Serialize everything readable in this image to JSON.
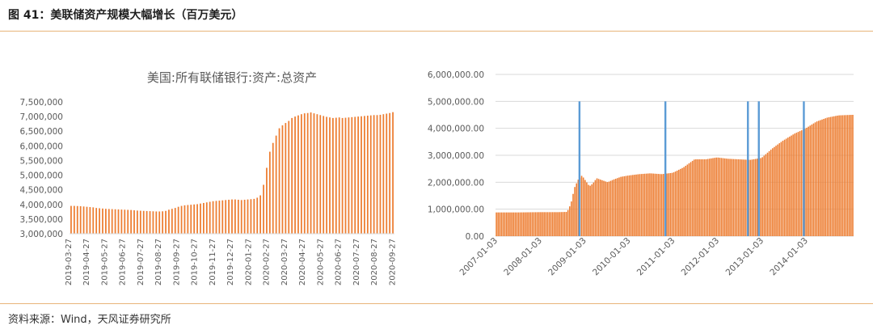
{
  "figure": {
    "title": "图 41：美联储资产规模大幅增长（百万美元）",
    "source": "资料来源：Wind，天风证券研究所"
  },
  "chart_data": [
    {
      "type": "bar",
      "title": "美国:所有联储银行:资产:总资产",
      "xlabel": "",
      "ylabel": "",
      "ylim": [
        3000000,
        7500000
      ],
      "yticks": [
        "3,000,000",
        "3,500,000",
        "4,000,000",
        "4,500,000",
        "5,000,000",
        "5,500,000",
        "6,000,000",
        "6,500,000",
        "7,000,000",
        "7,500,000"
      ],
      "xtick_labels": [
        "2019-03-27",
        "2019-04-27",
        "2019-05-27",
        "2019-06-27",
        "2019-07-27",
        "2019-08-27",
        "2019-09-27",
        "2019-10-27",
        "2019-11-27",
        "2019-12-27",
        "2020-01-27",
        "2020-02-27",
        "2020-03-27",
        "2020-04-27",
        "2020-05-27",
        "2020-06-27",
        "2020-07-27",
        "2020-08-27",
        "2020-09-27"
      ],
      "bar_color": "#ed7d31",
      "grid": false,
      "values": [
        3950000,
        3950000,
        3945000,
        3940000,
        3930000,
        3920000,
        3910000,
        3900000,
        3880000,
        3870000,
        3860000,
        3850000,
        3845000,
        3840000,
        3835000,
        3830000,
        3825000,
        3820000,
        3815000,
        3810000,
        3800000,
        3790000,
        3785000,
        3780000,
        3775000,
        3770000,
        3765000,
        3760000,
        3760000,
        3765000,
        3780000,
        3820000,
        3850000,
        3880000,
        3920000,
        3950000,
        3970000,
        3980000,
        3990000,
        4000000,
        4010000,
        4030000,
        4050000,
        4070000,
        4090000,
        4110000,
        4120000,
        4130000,
        4140000,
        4150000,
        4160000,
        4170000,
        4170000,
        4160000,
        4150000,
        4160000,
        4170000,
        4180000,
        4190000,
        4230000,
        4310000,
        4670000,
        5250000,
        5800000,
        6100000,
        6350000,
        6600000,
        6700000,
        6780000,
        6850000,
        6950000,
        7000000,
        7040000,
        7080000,
        7110000,
        7120000,
        7140000,
        7110000,
        7080000,
        7050000,
        7020000,
        6990000,
        6970000,
        6950000,
        6960000,
        6970000,
        6950000,
        6960000,
        6970000,
        6980000,
        6990000,
        7000000,
        7010000,
        7020000,
        7030000,
        7040000,
        7050000,
        7050000,
        7060000,
        7080000,
        7100000,
        7120000,
        7150000
      ]
    },
    {
      "type": "bar",
      "title": "",
      "ylim": [
        0,
        6000000
      ],
      "yticks": [
        "0.00",
        "1,000,000.00",
        "2,000,000.00",
        "3,000,000.00",
        "4,000,000.00",
        "5,000,000.00",
        "6,000,000.00"
      ],
      "xtick_labels": [
        "2007-01-03",
        "2008-01-03",
        "2009-01-03",
        "2010-01-03",
        "2011-01-03",
        "2012-01-03",
        "2013-01-03",
        "2014-01-03"
      ],
      "x_range": [
        "2007-01-03",
        "2015-02-01"
      ],
      "bar_color": "#ed7d31",
      "marker_color": "#5b9bd5",
      "grid": true,
      "series": [
        {
          "x": "2007-01-03",
          "y": 880000
        },
        {
          "x": "2007-07-01",
          "y": 880000
        },
        {
          "x": "2008-01-01",
          "y": 890000
        },
        {
          "x": "2008-06-01",
          "y": 890000
        },
        {
          "x": "2008-08-15",
          "y": 900000
        },
        {
          "x": "2008-09-15",
          "y": 1200000
        },
        {
          "x": "2008-10-15",
          "y": 1800000
        },
        {
          "x": "2008-11-15",
          "y": 2100000
        },
        {
          "x": "2008-12-15",
          "y": 2250000
        },
        {
          "x": "2009-01-15",
          "y": 2050000
        },
        {
          "x": "2009-02-15",
          "y": 1850000
        },
        {
          "x": "2009-03-15",
          "y": 1950000
        },
        {
          "x": "2009-04-15",
          "y": 2150000
        },
        {
          "x": "2009-05-15",
          "y": 2100000
        },
        {
          "x": "2009-06-15",
          "y": 2050000
        },
        {
          "x": "2009-07-15",
          "y": 2000000
        },
        {
          "x": "2009-09-01",
          "y": 2100000
        },
        {
          "x": "2009-11-01",
          "y": 2200000
        },
        {
          "x": "2010-01-03",
          "y": 2250000
        },
        {
          "x": "2010-04-01",
          "y": 2300000
        },
        {
          "x": "2010-07-01",
          "y": 2330000
        },
        {
          "x": "2010-10-01",
          "y": 2300000
        },
        {
          "x": "2011-01-03",
          "y": 2350000
        },
        {
          "x": "2011-04-01",
          "y": 2550000
        },
        {
          "x": "2011-07-01",
          "y": 2850000
        },
        {
          "x": "2011-10-01",
          "y": 2850000
        },
        {
          "x": "2012-01-03",
          "y": 2920000
        },
        {
          "x": "2012-04-01",
          "y": 2870000
        },
        {
          "x": "2012-07-01",
          "y": 2850000
        },
        {
          "x": "2012-10-01",
          "y": 2830000
        },
        {
          "x": "2013-01-03",
          "y": 2900000
        },
        {
          "x": "2013-04-01",
          "y": 3250000
        },
        {
          "x": "2013-07-01",
          "y": 3550000
        },
        {
          "x": "2013-10-01",
          "y": 3800000
        },
        {
          "x": "2014-01-03",
          "y": 4000000
        },
        {
          "x": "2014-04-01",
          "y": 4250000
        },
        {
          "x": "2014-07-01",
          "y": 4400000
        },
        {
          "x": "2014-10-01",
          "y": 4480000
        },
        {
          "x": "2015-01-20",
          "y": 4500000
        }
      ],
      "markers": [
        {
          "x": "2008-11-25",
          "y": 5000000
        },
        {
          "x": "2010-11-03",
          "y": 5000000
        },
        {
          "x": "2012-09-13",
          "y": 5000000
        },
        {
          "x": "2012-12-12",
          "y": 5000000
        },
        {
          "x": "2013-12-18",
          "y": 5000000
        }
      ]
    }
  ]
}
